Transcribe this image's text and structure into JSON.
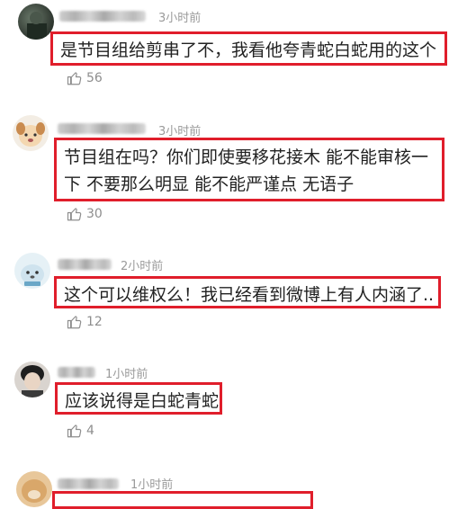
{
  "comments": [
    {
      "time": "3小时前",
      "text": "是节目组给剪串了不，我看他夸青蛇白蛇用的这个",
      "likes": "56",
      "avatar": "dark-photo-avatar"
    },
    {
      "time": "3小时前",
      "text": "节目组在吗？你们即使要移花接木 能不能审核一下 不要那么明显  能不能严谨点 无语子",
      "likes": "30",
      "avatar": "cartoon-dog-avatar"
    },
    {
      "time": "2小时前",
      "text": "这个可以维权么！我已经看到微博上有人内涵了..",
      "likes": "12",
      "avatar": "cartoon-seal-avatar"
    },
    {
      "time": "1小时前",
      "text": "应该说得是白蛇青蛇",
      "likes": "4",
      "avatar": "person-photo-avatar"
    },
    {
      "time": "1小时前",
      "text": "",
      "likes": "",
      "avatar": "dog-photo-avatar"
    }
  ],
  "colors": {
    "highlight": "#e01e2b",
    "meta": "#9a9a9a"
  }
}
